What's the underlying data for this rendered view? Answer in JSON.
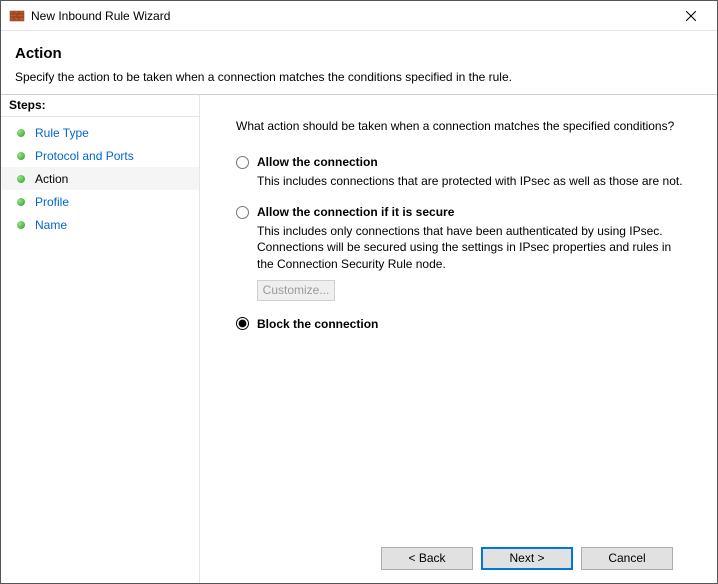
{
  "window": {
    "title": "New Inbound Rule Wizard"
  },
  "header": {
    "title": "Action",
    "subtitle": "Specify the action to be taken when a connection matches the conditions specified in the rule."
  },
  "steps": {
    "header": "Steps:",
    "items": [
      {
        "label": "Rule Type",
        "active": false
      },
      {
        "label": "Protocol and Ports",
        "active": false
      },
      {
        "label": "Action",
        "active": true
      },
      {
        "label": "Profile",
        "active": false
      },
      {
        "label": "Name",
        "active": false
      }
    ]
  },
  "main": {
    "question": "What action should be taken when a connection matches the specified conditions?",
    "options": [
      {
        "id": "allow",
        "label": "Allow the connection",
        "desc": "This includes connections that are protected with IPsec as well as those are not.",
        "selected": false
      },
      {
        "id": "allow-secure",
        "label": "Allow the connection if it is secure",
        "desc": "This includes only connections that have been authenticated by using IPsec.  Connections will be secured using the settings in IPsec properties and rules in the Connection Security Rule node.",
        "selected": false,
        "customize": "Customize..."
      },
      {
        "id": "block",
        "label": "Block the connection",
        "desc": "",
        "selected": true
      }
    ]
  },
  "footer": {
    "back": "< Back",
    "next": "Next >",
    "cancel": "Cancel"
  }
}
